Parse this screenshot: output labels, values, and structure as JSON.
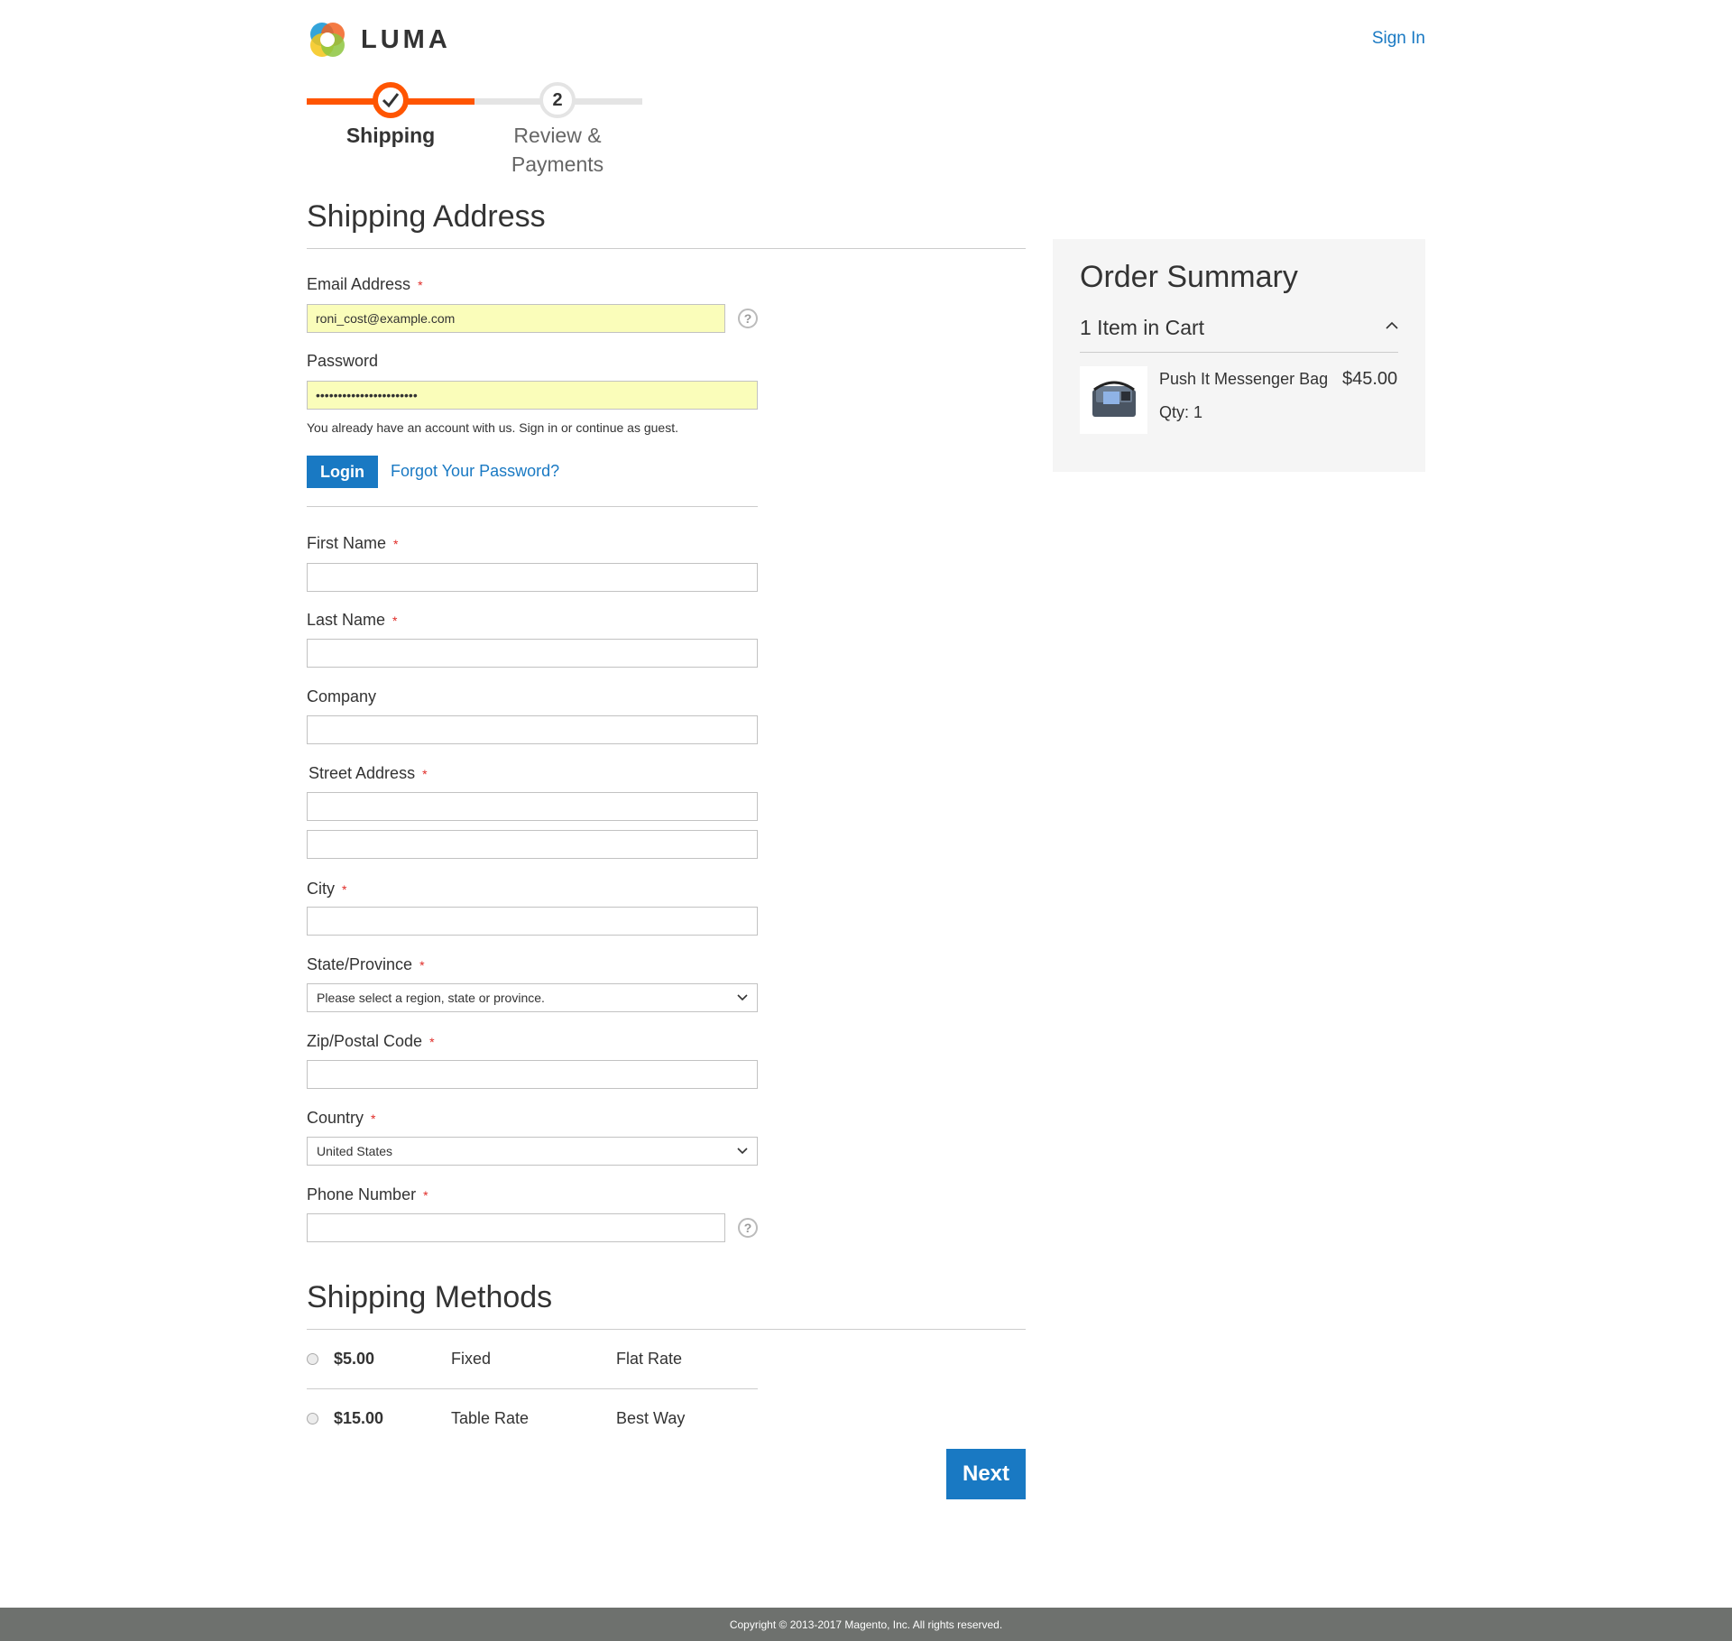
{
  "header": {
    "logo_text": "LUMA",
    "sign_in": "Sign In"
  },
  "progress": {
    "steps": [
      {
        "label": "Shipping",
        "state": "complete"
      },
      {
        "number": "2",
        "label_line1": "Review &",
        "label_line2": "Payments",
        "state": "pending"
      }
    ]
  },
  "shipping_address": {
    "title": "Shipping Address",
    "required_mark": "*",
    "email": {
      "label": "Email Address",
      "value": "roni_cost@example.com",
      "help": "?"
    },
    "password": {
      "label": "Password",
      "value": "•••••••••••••••••••••••"
    },
    "account_note": "You already have an account with us. Sign in or continue as guest.",
    "login_label": "Login",
    "forgot_label": "Forgot Your Password?",
    "first_name": {
      "label": "First Name",
      "value": ""
    },
    "last_name": {
      "label": "Last Name",
      "value": ""
    },
    "company": {
      "label": "Company",
      "value": ""
    },
    "street": {
      "label": "Street Address",
      "line1": "",
      "line2": ""
    },
    "city": {
      "label": "City",
      "value": ""
    },
    "state": {
      "label": "State/Province",
      "value": "Please select a region, state or province."
    },
    "zip": {
      "label": "Zip/Postal Code",
      "value": ""
    },
    "country": {
      "label": "Country",
      "value": "United States"
    },
    "phone": {
      "label": "Phone Number",
      "value": "",
      "help": "?"
    }
  },
  "shipping_methods": {
    "title": "Shipping Methods",
    "methods": [
      {
        "price": "$5.00",
        "method": "Fixed",
        "carrier": "Flat Rate"
      },
      {
        "price": "$15.00",
        "method": "Table Rate",
        "carrier": "Best Way"
      }
    ]
  },
  "next_label": "Next",
  "order_summary": {
    "title": "Order Summary",
    "items_in_cart": "1 Item in Cart",
    "items": [
      {
        "name": "Push It Messenger Bag",
        "price": "$45.00",
        "qty": "Qty: 1"
      }
    ]
  },
  "footer": {
    "copyright": "Copyright © 2013-2017 Magento, Inc. All rights reserved."
  },
  "colors": {
    "accent": "#1979c3",
    "progress": "#ff5501",
    "autofill": "#fafdba",
    "required": "#e02b27"
  }
}
